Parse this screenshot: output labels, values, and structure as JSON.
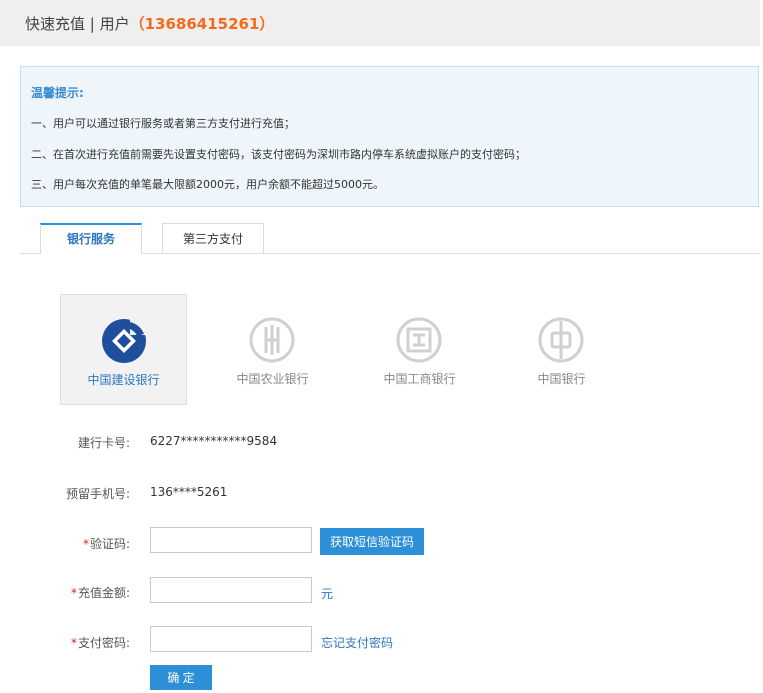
{
  "header": {
    "title": "快速充值 | 用户",
    "phone": "（13686415261）"
  },
  "notice": {
    "title": "温馨提示:",
    "lines": [
      "一、用户可以通过银行服务或者第三方支付进行充值；",
      "二、在首次进行充值前需要先设置支付密码，该支付密码为深圳市路内停车系统虚拟账户的支付密码；",
      "三、用户每次充值的单笔最大限额2000元，用户余额不能超过5000元。"
    ]
  },
  "tabs": [
    {
      "label": "银行服务",
      "active": true
    },
    {
      "label": "第三方支付",
      "active": false
    }
  ],
  "banks": [
    {
      "name": "中国建设银行",
      "icon": "ccb-logo-icon",
      "selected": true,
      "color": "#1f4e9c"
    },
    {
      "name": "中国农业银行",
      "icon": "abc-logo-icon",
      "selected": false,
      "color": "#d0d0d0"
    },
    {
      "name": "中国工商银行",
      "icon": "icbc-logo-icon",
      "selected": false,
      "color": "#d0d0d0"
    },
    {
      "name": "中国银行",
      "icon": "boc-logo-icon",
      "selected": false,
      "color": "#d0d0d0"
    }
  ],
  "form": {
    "card_label": "建行卡号:",
    "card_value": "6227***********9584",
    "phone_label": "预留手机号:",
    "phone_value": "136****5261",
    "required_mark": "*",
    "code_label": "验证码:",
    "code_value": "",
    "get_code_button": "获取短信验证码",
    "amount_label": "充值金额:",
    "amount_value": "",
    "amount_unit": "元",
    "pwd_label": "支付密码:",
    "pwd_value": "",
    "forgot_link": "忘记支付密码",
    "submit_button": "确 定"
  },
  "colors": {
    "accent": "#2c8fd7",
    "phone_highlight": "#f56a1a",
    "required": "#e02020"
  }
}
